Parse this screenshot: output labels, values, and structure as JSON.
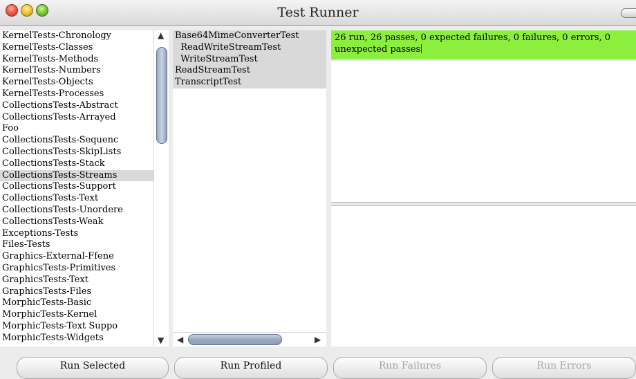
{
  "window": {
    "title": "Test Runner"
  },
  "categories": {
    "items": [
      "KernelTests-Chronology",
      "KernelTests-Classes",
      "KernelTests-Methods",
      "KernelTests-Numbers",
      "KernelTests-Objects",
      "KernelTests-Processes",
      "CollectionsTests-Abstract",
      "CollectionsTests-Arrayed",
      "Foo",
      "CollectionsTests-Sequenc",
      "CollectionsTests-SkipLists",
      "CollectionsTests-Stack",
      "CollectionsTests-Streams",
      "CollectionsTests-Support",
      "CollectionsTests-Text",
      "CollectionsTests-Unordere",
      "CollectionsTests-Weak",
      "Exceptions-Tests",
      "Files-Tests",
      "Graphics-External-Ffene",
      "GraphicsTests-Primitives",
      "GraphicsTests-Text",
      "GraphicsTests-Files",
      "MorphicTests-Basic",
      "MorphicTests-Kernel",
      "MorphicTests-Text Suppo",
      "MorphicTests-Widgets"
    ],
    "selected_index": 12
  },
  "classes": {
    "items": [
      "Base64MimeConverterTest",
      "  ReadWriteStreamTest",
      "  WriteStreamTest",
      "ReadStreamTest",
      "TranscriptTest"
    ]
  },
  "status": {
    "text": "26 run, 26 passes, 0 expected failures, 0 failures, 0 errors, 0 unexpected passes",
    "color": "#8cef3e"
  },
  "buttons": {
    "run_selected": "Run Selected",
    "run_profiled": "Run Profiled",
    "run_failures": "Run Failures",
    "run_errors": "Run Errors"
  },
  "icons": {
    "scroll_up": "▲",
    "scroll_down": "▼",
    "scroll_left": "◀",
    "scroll_right": "▶"
  }
}
